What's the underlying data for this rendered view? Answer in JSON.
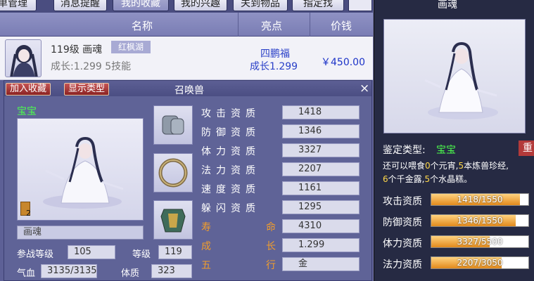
{
  "tabs": [
    {
      "label": "订单管理",
      "active": false
    },
    {
      "label": "消息提醒",
      "active": false
    },
    {
      "label": "我的收藏",
      "active": true
    },
    {
      "label": "我的兴趣",
      "active": false
    },
    {
      "label": "关到物品",
      "active": false
    },
    {
      "label": "指定找",
      "active": false
    }
  ],
  "table": {
    "headers": [
      "名称",
      "亮点",
      "价钱"
    ]
  },
  "listing": {
    "name": "119级 画魂",
    "server": "红枫湖",
    "growth_skills": "成长:1.299 5技能",
    "highlight1": "四鹏福",
    "highlight2": "成长1.299",
    "price": "￥450.00"
  },
  "pet_window": {
    "add_fav": "加入收藏",
    "show_type": "显示类型",
    "title": "召唤兽",
    "close": "×",
    "baby_label": "宝宝",
    "card_count": "2",
    "pet_name": "画魂",
    "stats": [
      {
        "label": "攻击资质",
        "value": "1418"
      },
      {
        "label": "防御资质",
        "value": "1346"
      },
      {
        "label": "体力资质",
        "value": "3327"
      },
      {
        "label": "法力资质",
        "value": "2207"
      },
      {
        "label": "速度资质",
        "value": "1161"
      },
      {
        "label": "躲闪资质",
        "value": "1295"
      }
    ],
    "orange_stats": [
      {
        "c1": "寿",
        "c2": "命",
        "value": "4310"
      },
      {
        "c1": "成",
        "c2": "长",
        "value": "1.299"
      },
      {
        "c1": "五",
        "c2": "行",
        "value": "金"
      }
    ],
    "battle_level_label": "参战等级",
    "battle_level": "105",
    "level_label": "等级",
    "level": "119",
    "hp_label": "气血",
    "hp": "3135/3135",
    "physique_label": "体质",
    "physique": "323"
  },
  "preview": {
    "title": "画魂",
    "type_label": "鉴定类型:",
    "type_value": "宝宝",
    "red_tab": "重",
    "feed_line1_a": "还可以喂食",
    "feed_n1": "0",
    "feed_line1_b": "个元宵,",
    "feed_n2": "5",
    "feed_line1_c": "本炼兽珍经,",
    "feed_n3": "6",
    "feed_line2_a": "个千金露,",
    "feed_n4": "5",
    "feed_line2_b": "个水晶糕。",
    "bars": [
      {
        "label": "攻击资质",
        "text": "1418/1550",
        "value": 1418,
        "max": 1550
      },
      {
        "label": "防御资质",
        "text": "1346/1550",
        "value": 1346,
        "max": 1550
      },
      {
        "label": "体力资质",
        "text": "3327/5500",
        "value": 3327,
        "max": 5500
      },
      {
        "label": "法力资质",
        "text": "2207/3050",
        "value": 2207,
        "max": 3050
      }
    ]
  }
}
